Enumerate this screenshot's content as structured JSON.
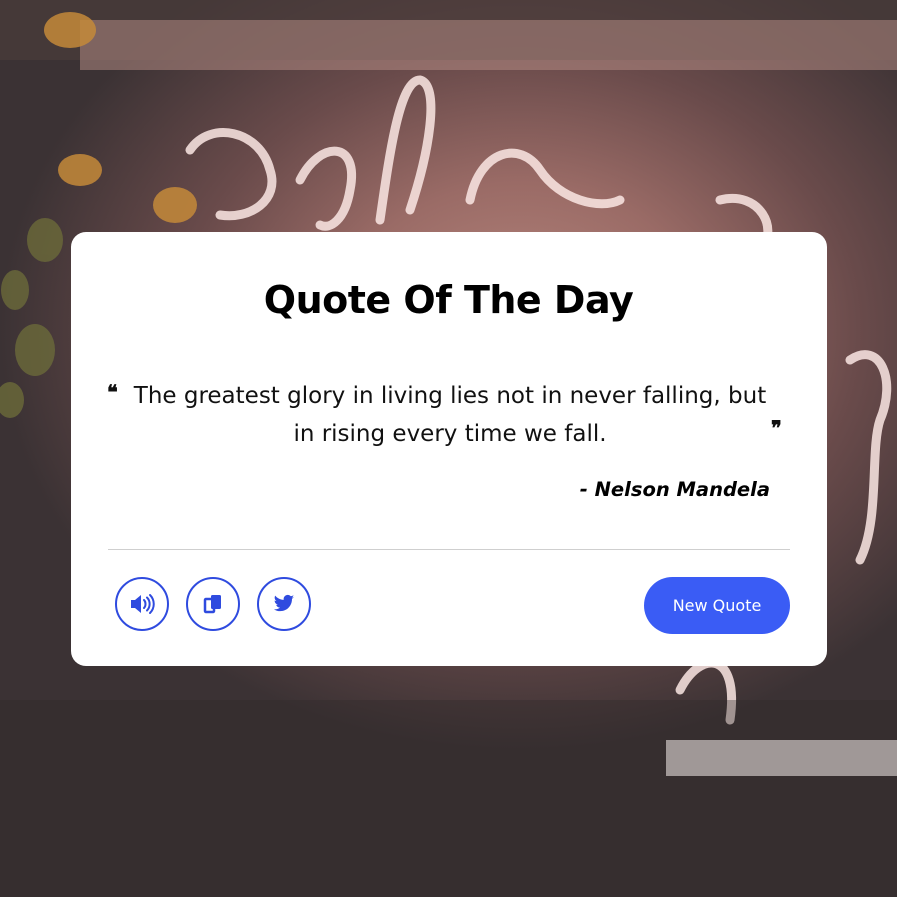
{
  "card": {
    "title": "Quote Of The Day",
    "quote_open_mark": "❝",
    "quote_close_mark": "❞",
    "quote_text": "The greatest glory in living lies not in never falling, but in rising every time we fall.",
    "author": "- Nelson Mandela"
  },
  "actions": {
    "speech_icon": "volume-icon",
    "copy_icon": "copy-icon",
    "twitter_icon": "twitter-icon",
    "new_quote_label": "New Quote"
  },
  "colors": {
    "accent": "#3a5cf5",
    "icon_border": "#2f4bdf",
    "card_bg": "#ffffff"
  }
}
